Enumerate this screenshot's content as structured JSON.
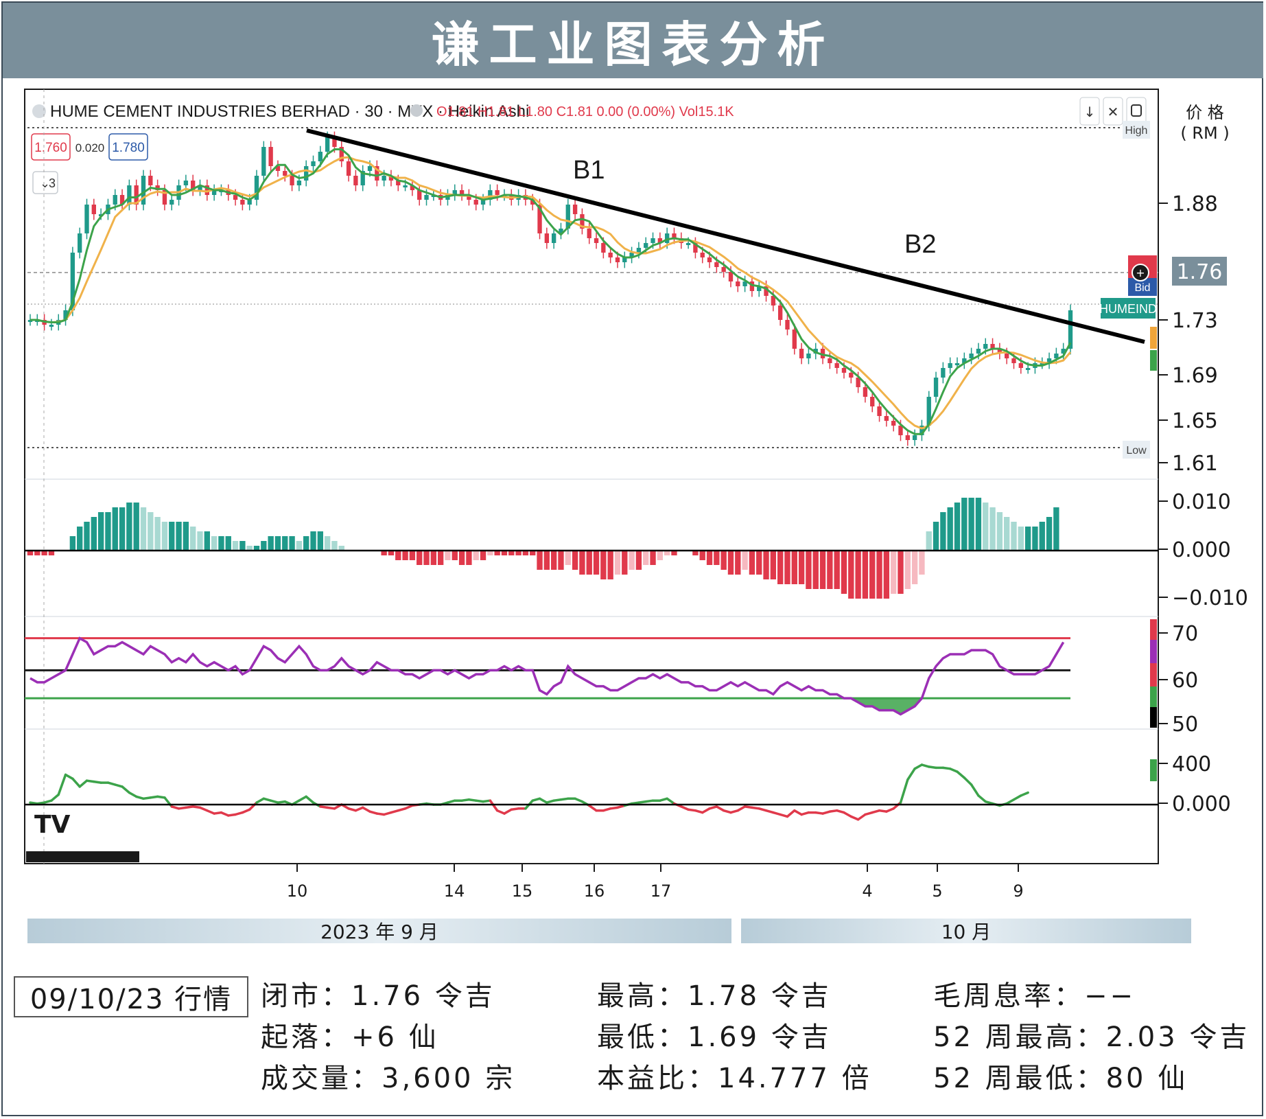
{
  "banner": {
    "title": "谦工业图表分析"
  },
  "chart_header": {
    "symbol": "HUME CEMENT INDUSTRIES BERHAD · 30 · MYX · Heikin Ashi",
    "ohlc": "O1.81  H1.81  L1.80  C1.81  0.00 (0.00%)  Vol15.1K",
    "sell_price": "1.760",
    "spread": "0.020",
    "buy_price": "1.780",
    "indicator_toggle": "3",
    "high_tag": "High",
    "low_tag": "Low",
    "bid_tag": "Bid",
    "ticker_tag": "HUMEIND"
  },
  "y_axis_title": [
    "价 格",
    "( RM )"
  ],
  "annotations": {
    "b1": "B1",
    "b2": "B2"
  },
  "chart_data": [
    {
      "type": "candlestick",
      "name": "price",
      "y_ticks": [
        "1.88",
        "1.76",
        "1.73",
        "1.69",
        "1.65",
        "1.61"
      ],
      "current_price": "1.76",
      "ylim": [
        1.59,
        1.95
      ],
      "close": [
        1.75,
        1.75,
        1.745,
        1.745,
        1.75,
        1.76,
        1.82,
        1.84,
        1.87,
        1.86,
        1.86,
        1.87,
        1.88,
        1.87,
        1.89,
        1.87,
        1.9,
        1.89,
        1.885,
        1.87,
        1.875,
        1.89,
        1.895,
        1.885,
        1.89,
        1.88,
        1.885,
        1.885,
        1.88,
        1.875,
        1.87,
        1.875,
        1.9,
        1.93,
        1.91,
        1.905,
        1.9,
        1.89,
        1.895,
        1.91,
        1.915,
        1.925,
        1.94,
        1.93,
        1.915,
        1.9,
        1.89,
        1.905,
        1.91,
        1.895,
        1.9,
        1.895,
        1.89,
        1.89,
        1.885,
        1.875,
        1.88,
        1.88,
        1.875,
        1.88,
        1.885,
        1.88,
        1.875,
        1.87,
        1.875,
        1.885,
        1.88,
        1.88,
        1.875,
        1.88,
        1.875,
        1.87,
        1.84,
        1.83,
        1.84,
        1.845,
        1.87,
        1.86,
        1.845,
        1.835,
        1.83,
        1.82,
        1.815,
        1.81,
        1.815,
        1.82,
        1.825,
        1.83,
        1.835,
        1.83,
        1.84,
        1.835,
        1.83,
        1.83,
        1.82,
        1.815,
        1.81,
        1.805,
        1.8,
        1.79,
        1.785,
        1.79,
        1.78,
        1.785,
        1.775,
        1.765,
        1.75,
        1.74,
        1.72,
        1.71,
        1.715,
        1.72,
        1.71,
        1.705,
        1.7,
        1.695,
        1.69,
        1.68,
        1.67,
        1.66,
        1.65,
        1.645,
        1.64,
        1.63,
        1.625,
        1.63,
        1.64,
        1.67,
        1.69,
        1.7,
        1.705,
        1.705,
        1.71,
        1.715,
        1.72,
        1.725,
        1.72,
        1.715,
        1.71,
        1.705,
        1.7,
        1.7,
        1.705,
        1.705,
        1.71,
        1.715,
        1.72,
        1.76
      ],
      "fast_ma_color": "#3ca34a",
      "slow_ma_color": "#f0b24a",
      "trendline": {
        "from": [
          "2023-09-10",
          1.945
        ],
        "to": [
          "2023-10-09",
          1.72
        ]
      }
    },
    {
      "type": "histogram",
      "name": "momentum",
      "y_ticks": [
        "0.010",
        "0.000",
        "−0.010"
      ],
      "ylim": [
        -0.013,
        0.013
      ],
      "values": [
        -0.001,
        -0.001,
        -0.001,
        -0.001,
        0,
        0,
        0.003,
        0.005,
        0.006,
        0.007,
        0.008,
        0.008,
        0.009,
        0.009,
        0.01,
        0.01,
        0.009,
        0.008,
        0.007,
        0.006,
        0.006,
        0.006,
        0.006,
        0.005,
        0.004,
        0.004,
        0.003,
        0.003,
        0.003,
        0.002,
        0.002,
        0.001,
        0.001,
        0.002,
        0.003,
        0.003,
        0.003,
        0.003,
        0.002,
        0.003,
        0.004,
        0.004,
        0.003,
        0.002,
        0.001,
        0,
        0,
        0,
        0,
        0,
        -0.001,
        -0.001,
        -0.002,
        -0.002,
        -0.002,
        -0.003,
        -0.003,
        -0.003,
        -0.003,
        -0.002,
        -0.002,
        -0.003,
        -0.003,
        -0.002,
        -0.002,
        -0.001,
        -0.001,
        -0.001,
        -0.001,
        -0.001,
        -0.001,
        -0.001,
        -0.004,
        -0.004,
        -0.004,
        -0.004,
        -0.003,
        -0.004,
        -0.005,
        -0.005,
        -0.005,
        -0.006,
        -0.006,
        -0.005,
        -0.005,
        -0.004,
        -0.004,
        -0.003,
        -0.003,
        -0.002,
        -0.001,
        -0.001,
        0,
        0,
        -0.001,
        -0.002,
        -0.003,
        -0.003,
        -0.004,
        -0.005,
        -0.005,
        -0.004,
        -0.005,
        -0.005,
        -0.006,
        -0.006,
        -0.007,
        -0.007,
        -0.007,
        -0.007,
        -0.008,
        -0.008,
        -0.008,
        -0.008,
        -0.008,
        -0.009,
        -0.01,
        -0.01,
        -0.01,
        -0.01,
        -0.01,
        -0.01,
        -0.009,
        -0.009,
        -0.008,
        -0.007,
        -0.005,
        0.004,
        0.006,
        0.008,
        0.009,
        0.01,
        0.011,
        0.011,
        0.011,
        0.01,
        0.009,
        0.008,
        0.007,
        0.006,
        0.005,
        0.005,
        0.005,
        0.006,
        0.007,
        0.009
      ]
    },
    {
      "type": "line",
      "name": "oscillator",
      "y_ticks": [
        "70",
        "60",
        "50"
      ],
      "ylim": [
        48,
        72
      ],
      "bands": [
        70,
        62,
        55
      ],
      "band_colors": [
        "#e0394b",
        "#1a1a1a",
        "#3ca34a"
      ],
      "line_color": "#9b2fb5",
      "values": [
        60,
        59,
        59,
        60,
        61,
        62,
        66,
        70,
        69,
        66,
        67,
        68,
        68,
        69,
        68,
        67,
        66,
        68,
        67,
        66,
        64,
        65,
        64,
        66,
        64,
        63,
        64,
        63,
        62,
        63,
        61,
        62,
        65,
        68,
        67,
        65,
        64,
        66,
        68,
        66,
        63,
        62,
        62,
        63,
        65,
        63,
        62,
        61,
        62,
        64,
        63,
        62,
        62,
        61,
        61,
        60,
        61,
        62,
        62,
        61,
        62,
        61,
        60,
        61,
        61,
        62,
        62,
        63,
        62,
        63,
        62,
        62,
        57,
        56,
        58,
        59,
        63,
        61,
        60,
        59,
        58,
        58,
        57,
        57,
        58,
        59,
        60,
        60,
        61,
        60,
        61,
        60,
        59,
        59,
        58,
        58,
        57,
        57,
        58,
        59,
        58,
        59,
        58,
        57,
        57,
        56,
        58,
        59,
        58,
        57,
        58,
        57,
        57,
        56,
        56,
        55,
        55,
        54,
        53,
        53,
        52,
        52,
        52,
        51,
        52,
        53,
        55,
        60,
        63,
        65,
        66,
        66,
        66,
        67,
        67,
        67,
        66,
        63,
        62,
        61,
        61,
        61,
        61,
        62,
        63,
        66,
        69
      ]
    },
    {
      "type": "line",
      "name": "trend-oscillator",
      "y_ticks": [
        "400",
        "0.000"
      ],
      "ylim": [
        -280,
        560
      ],
      "line_color_positive": "#3ca34a",
      "line_color_negative": "#e0394b",
      "values": [
        20,
        10,
        20,
        40,
        100,
        300,
        260,
        180,
        240,
        230,
        220,
        220,
        200,
        180,
        120,
        80,
        60,
        70,
        80,
        70,
        -20,
        -40,
        -30,
        -20,
        -30,
        -60,
        -90,
        -80,
        -110,
        -100,
        -80,
        -50,
        20,
        60,
        40,
        20,
        30,
        0,
        40,
        80,
        20,
        -20,
        -30,
        -40,
        0,
        -40,
        -60,
        -30,
        -70,
        -90,
        -100,
        -80,
        -60,
        -40,
        -10,
        0,
        10,
        0,
        0,
        20,
        40,
        40,
        50,
        40,
        30,
        40,
        -60,
        -90,
        -50,
        -40,
        -40,
        40,
        60,
        20,
        40,
        50,
        60,
        60,
        30,
        -10,
        -60,
        -60,
        -40,
        -30,
        -10,
        10,
        20,
        30,
        40,
        40,
        60,
        10,
        -20,
        -50,
        -60,
        -80,
        -40,
        -20,
        -60,
        -80,
        -60,
        -20,
        -30,
        -40,
        -60,
        -80,
        -100,
        -120,
        -60,
        -100,
        -80,
        -80,
        -90,
        -70,
        -60,
        -80,
        -120,
        -150,
        -100,
        -80,
        -60,
        -70,
        -40,
        20,
        250,
        360,
        400,
        380,
        370,
        370,
        360,
        330,
        270,
        200,
        90,
        30,
        10,
        -10,
        10,
        50,
        90,
        120
      ]
    },
    {
      "type": "axis",
      "name": "time",
      "x_ticks": [
        "10",
        "14",
        "15",
        "16",
        "17",
        "4",
        "5",
        "9"
      ],
      "month_labels": [
        "2023 年 9 月",
        "10 月"
      ]
    }
  ],
  "info": {
    "date_label": "09/10/23 行情",
    "close": "闭市：1.76 令吉",
    "change": "起落：+6 仙",
    "volume": "成交量：3,600 宗",
    "high": "最高：1.78 令吉",
    "low": "最低：1.69 令吉",
    "pe": "本益比：14.777 倍",
    "dividend_yield": "毛周息率：−−",
    "week52_high": "52 周最高：2.03 令吉",
    "week52_low": "52 周最低：80 仙"
  },
  "colors": {
    "up": "#1f9a8a",
    "down": "#e0394b",
    "up_light": "#a8d9d2",
    "down_light": "#f6b9c0",
    "trend": "#000000",
    "banner": "#7a8f9b"
  }
}
